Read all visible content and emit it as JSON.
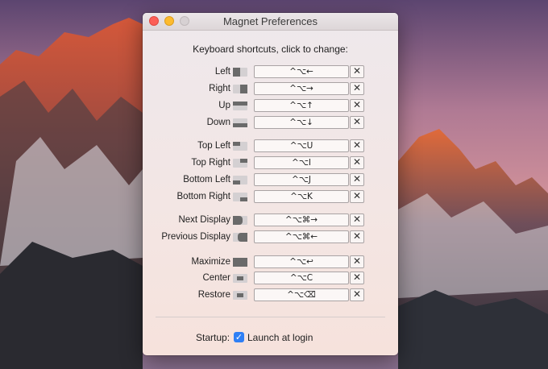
{
  "window": {
    "title": "Magnet Preferences",
    "heading": "Keyboard shortcuts, click to change:",
    "clear_glyph": "✕"
  },
  "shortcuts": [
    {
      "label": "Left",
      "keys": "^⌥←",
      "icon": "left-half-icon"
    },
    {
      "label": "Right",
      "keys": "^⌥→",
      "icon": "right-half-icon"
    },
    {
      "label": "Up",
      "keys": "^⌥↑",
      "icon": "top-half-icon"
    },
    {
      "label": "Down",
      "keys": "^⌥↓",
      "icon": "bottom-half-icon"
    },
    {
      "label": "Top Left",
      "keys": "^⌥U",
      "icon": "top-left-quarter-icon"
    },
    {
      "label": "Top Right",
      "keys": "^⌥I",
      "icon": "top-right-quarter-icon"
    },
    {
      "label": "Bottom Left",
      "keys": "^⌥J",
      "icon": "bottom-left-quarter-icon"
    },
    {
      "label": "Bottom Right",
      "keys": "^⌥K",
      "icon": "bottom-right-quarter-icon"
    },
    {
      "label": "Next Display",
      "keys": "^⌥⌘→",
      "icon": "next-display-icon"
    },
    {
      "label": "Previous Display",
      "keys": "^⌥⌘←",
      "icon": "previous-display-icon"
    },
    {
      "label": "Maximize",
      "keys": "^⌥↩",
      "icon": "maximize-icon"
    },
    {
      "label": "Center",
      "keys": "^⌥C",
      "icon": "center-icon"
    },
    {
      "label": "Restore",
      "keys": "^⌥⌫",
      "icon": "restore-icon"
    }
  ],
  "startup": {
    "label": "Startup:",
    "checkbox_label": "Launch at login",
    "checked": true,
    "check_glyph": "✓"
  },
  "colors": {
    "close": "#fc5f57",
    "minimize": "#fdbb2e",
    "zoom": "#d7d1d3",
    "checkbox_accent": "#2f7ff5"
  }
}
